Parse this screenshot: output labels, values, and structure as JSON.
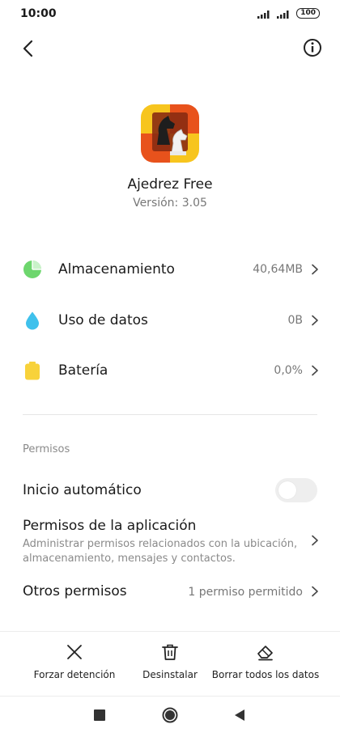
{
  "status_bar": {
    "time": "10:00",
    "battery": "100"
  },
  "app": {
    "name": "Ajedrez Free",
    "version": "Versión: 3.05"
  },
  "usage": [
    {
      "label": "Almacenamiento",
      "value": "40,64MB",
      "icon": "storage-pie-icon",
      "color": "#6dd66d"
    },
    {
      "label": "Uso de datos",
      "value": "0B",
      "icon": "data-drop-icon",
      "color": "#3fc1ec"
    },
    {
      "label": "Batería",
      "value": "0,0%",
      "icon": "battery-icon",
      "color": "#f8d23a"
    }
  ],
  "permissions": {
    "section_title": "Permisos",
    "autostart_label": "Inicio automático",
    "autostart_on": false,
    "app_permissions_label": "Permisos de la aplicación",
    "app_permissions_desc": "Administrar permisos relacionados con la ubicación, almacenamiento, mensajes y contactos.",
    "other_permissions_label": "Otros permisos",
    "other_permissions_value": "1 permiso permitido"
  },
  "actions": [
    {
      "label": "Forzar detención",
      "icon": "close-icon"
    },
    {
      "label": "Desinstalar",
      "icon": "trash-icon"
    },
    {
      "label": "Borrar todos los datos",
      "icon": "eraser-icon"
    }
  ]
}
